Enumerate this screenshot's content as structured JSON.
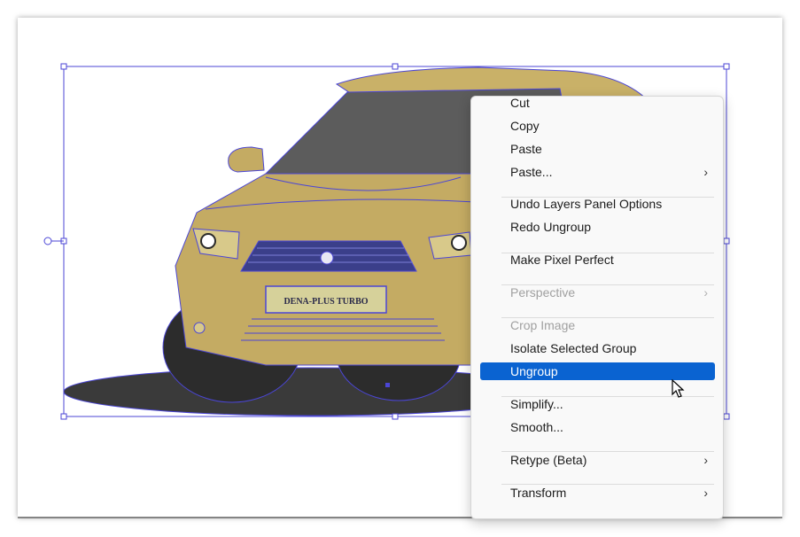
{
  "artwork": {
    "plate_text": "DENA-PLUS TURBO",
    "colors": {
      "body": "#c4ab63",
      "selection": "#4b46d6",
      "shadow": "#3a3a3a",
      "glass": "#5c5c5c"
    }
  },
  "context_menu": {
    "items": [
      {
        "label": "Cut",
        "disabled": false
      },
      {
        "label": "Copy",
        "disabled": false
      },
      {
        "label": "Paste",
        "disabled": false
      },
      {
        "label": "Paste...",
        "disabled": false,
        "submenu": "›"
      },
      {
        "label": "Undo Layers Panel Options",
        "disabled": false
      },
      {
        "label": "Redo Ungroup",
        "disabled": false
      },
      {
        "label": "Make Pixel Perfect",
        "disabled": false
      },
      {
        "label": "Perspective",
        "disabled": true,
        "submenu": "›"
      },
      {
        "label": "Crop Image",
        "disabled": true
      },
      {
        "label": "Isolate Selected Group",
        "disabled": false
      },
      {
        "label": "Ungroup",
        "disabled": false,
        "selected": true
      },
      {
        "label": "Simplify...",
        "disabled": false
      },
      {
        "label": "Smooth...",
        "disabled": false
      },
      {
        "label": "Retype (Beta)",
        "disabled": false,
        "submenu": "›"
      },
      {
        "label": "Transform",
        "disabled": false,
        "submenu": "›"
      }
    ]
  },
  "icons": {
    "submenu": "chevron-right-icon",
    "pointer": "mouse-pointer-icon"
  }
}
